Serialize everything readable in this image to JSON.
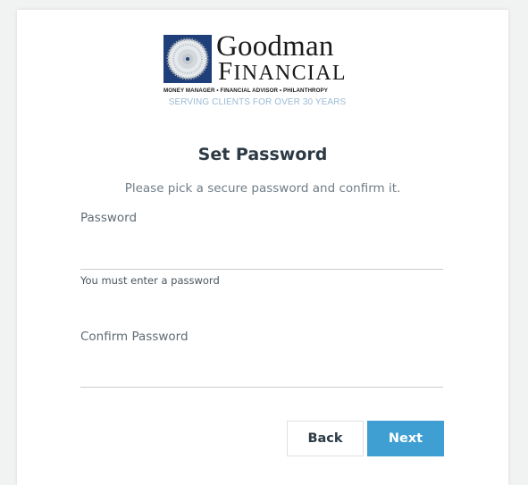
{
  "logo": {
    "name": "Goodman",
    "sub_first": "F",
    "sub_rest": "INANCIAL",
    "tagline": "MONEY MANAGER • FINANCIAL ADVISOR • PHILANTHROPY",
    "slogan": "SERVING CLIENTS FOR OVER 30 YEARS",
    "emblem_color": "#1f3f7a"
  },
  "heading": {
    "title": "Set Password",
    "subtitle": "Please pick a secure password and confirm it."
  },
  "form": {
    "password": {
      "label": "Password",
      "value": "",
      "placeholder": "",
      "error": "You must enter a password"
    },
    "confirm": {
      "label": "Confirm Password",
      "value": "",
      "placeholder": ""
    }
  },
  "buttons": {
    "back": "Back",
    "next": "Next"
  },
  "colors": {
    "accent": "#3f9fd2",
    "title": "#2c3a45",
    "background": "#f1f2f2"
  }
}
